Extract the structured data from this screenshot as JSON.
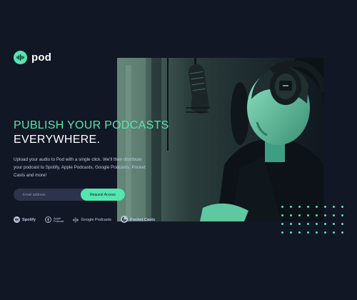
{
  "brand": {
    "name": "pod",
    "icon": "waveform-icon",
    "accent": "#54E6AF",
    "background": "#121725"
  },
  "hero": {
    "headline_line1": "PUBLISH YOUR PODCASTS",
    "headline_line2": "EVERYWHERE.",
    "description": "Upload your audio to Pod with a single click. We'll then distribute your podcast to Spotify, Apple Podcasts, Google Podcasts, Pocket Casts and more!",
    "image": "podcaster-at-microphone-photo"
  },
  "signup": {
    "email_placeholder": "Email address",
    "button_label": "Request Access"
  },
  "platforms": [
    {
      "name": "Spotify",
      "icon": "spotify-icon"
    },
    {
      "name_line1": "Apple",
      "name_line2": "Podcast",
      "icon": "apple-podcasts-icon"
    },
    {
      "name": "Google Podcasts",
      "icon": "google-podcasts-icon"
    },
    {
      "name": "Pocket Casts",
      "icon": "pocket-casts-icon"
    }
  ],
  "decoration": {
    "dot_rows": 4,
    "dot_cols": 8
  }
}
